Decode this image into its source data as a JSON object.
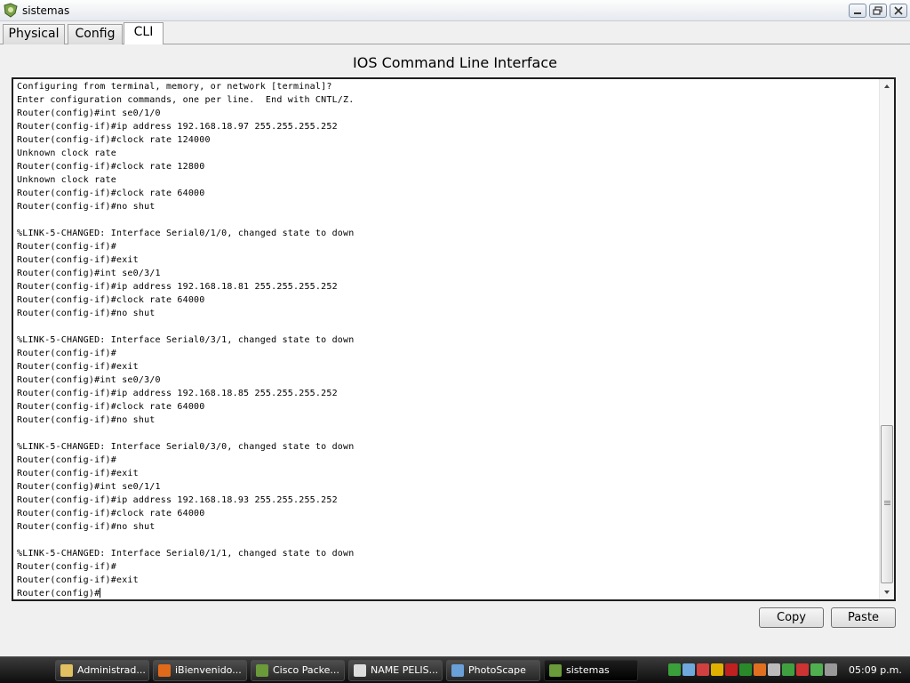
{
  "window": {
    "title": "sistemas"
  },
  "tabs": [
    {
      "label": "Physical"
    },
    {
      "label": "Config"
    },
    {
      "label": "CLI"
    }
  ],
  "cli": {
    "heading": "IOS Command Line Interface",
    "lines": [
      "Configuring from terminal, memory, or network [terminal]?",
      "Enter configuration commands, one per line.  End with CNTL/Z.",
      "Router(config)#int se0/1/0",
      "Router(config-if)#ip address 192.168.18.97 255.255.255.252",
      "Router(config-if)#clock rate 124000",
      "Unknown clock rate",
      "Router(config-if)#clock rate 12800",
      "Unknown clock rate",
      "Router(config-if)#clock rate 64000",
      "Router(config-if)#no shut",
      "",
      "%LINK-5-CHANGED: Interface Serial0/1/0, changed state to down",
      "Router(config-if)#",
      "Router(config-if)#exit",
      "Router(config)#int se0/3/1",
      "Router(config-if)#ip address 192.168.18.81 255.255.255.252",
      "Router(config-if)#clock rate 64000",
      "Router(config-if)#no shut",
      "",
      "%LINK-5-CHANGED: Interface Serial0/3/1, changed state to down",
      "Router(config-if)#",
      "Router(config-if)#exit",
      "Router(config)#int se0/3/0",
      "Router(config-if)#ip address 192.168.18.85 255.255.255.252",
      "Router(config-if)#clock rate 64000",
      "Router(config-if)#no shut",
      "",
      "%LINK-5-CHANGED: Interface Serial0/3/0, changed state to down",
      "Router(config-if)#",
      "Router(config-if)#exit",
      "Router(config)#int se0/1/1",
      "Router(config-if)#ip address 192.168.18.93 255.255.255.252",
      "Router(config-if)#clock rate 64000",
      "Router(config-if)#no shut",
      "",
      "%LINK-5-CHANGED: Interface Serial0/1/1, changed state to down",
      "Router(config-if)#",
      "Router(config-if)#exit",
      "Router(config)#"
    ]
  },
  "buttons": {
    "copy": "Copy",
    "paste": "Paste"
  },
  "taskbar": {
    "items": [
      {
        "label": "Administrad...",
        "icon": "folder-icon",
        "color": "#e0c060"
      },
      {
        "label": "iBienvenido...",
        "icon": "firefox-icon",
        "color": "#e06a1a"
      },
      {
        "label": "Cisco Packe...",
        "icon": "packet-tracer-icon",
        "color": "#6a9a3a"
      },
      {
        "label": "NAME PELIS...",
        "icon": "document-icon",
        "color": "#dcdcdc"
      },
      {
        "label": "PhotoScape",
        "icon": "photoscape-icon",
        "color": "#6aa0d8"
      },
      {
        "label": "sistemas",
        "icon": "router-icon",
        "color": "#6a9a3a"
      }
    ],
    "tray_icons": [
      "network-icon",
      "people-icon",
      "display-icon",
      "shield-icon",
      "antivirus-icon",
      "nvidia-icon",
      "messenger-icon",
      "volume-icon",
      "checkmark-icon",
      "update-icon",
      "monitor-icon",
      "battery-icon"
    ],
    "clock": "05:09 p.m."
  }
}
